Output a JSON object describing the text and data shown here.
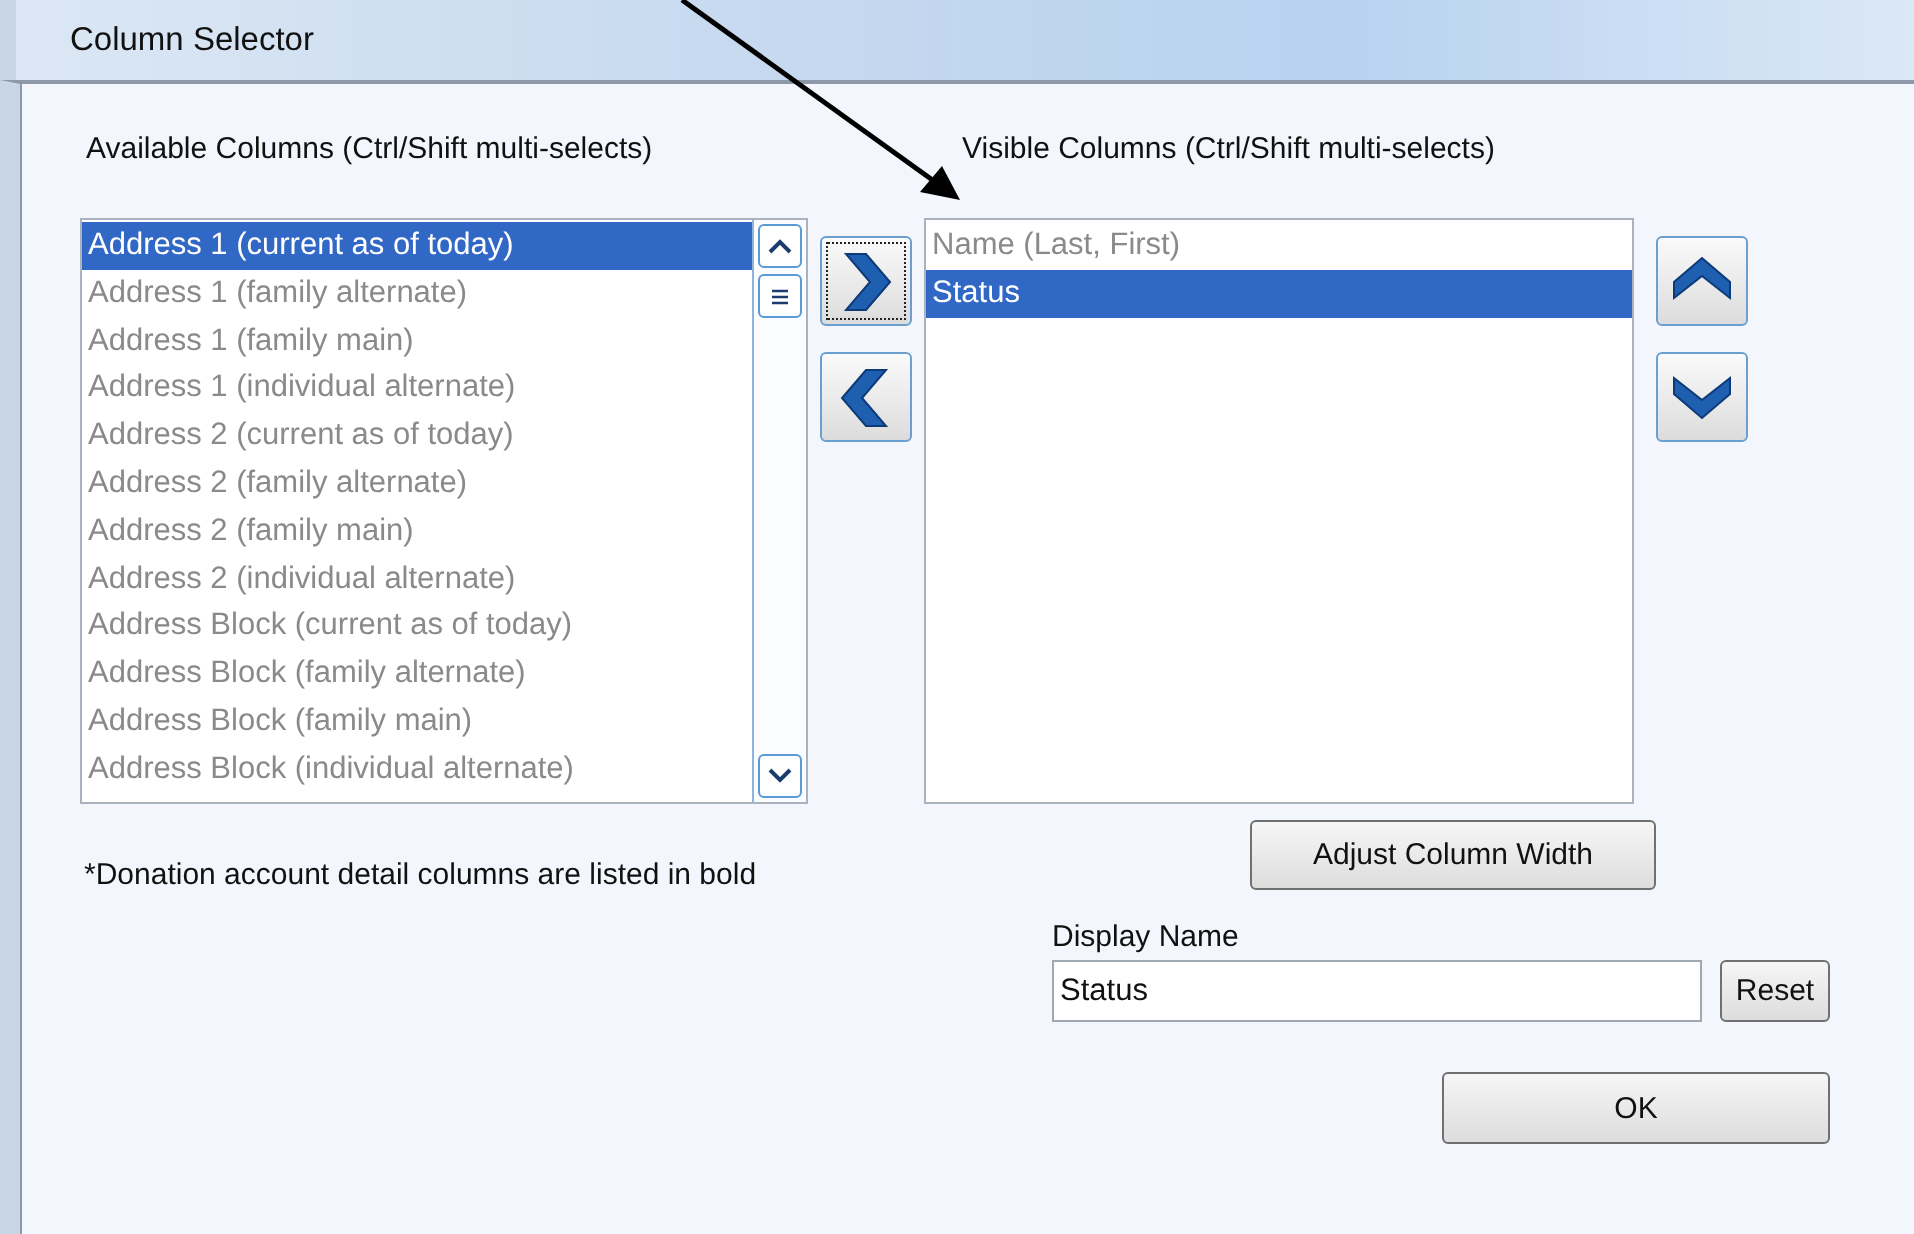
{
  "window": {
    "title": "Column Selector"
  },
  "available": {
    "label": "Available Columns (Ctrl/Shift multi-selects)",
    "items": [
      {
        "text": "Address 1 (current as of today)",
        "selected": true
      },
      {
        "text": "Address 1 (family alternate)",
        "selected": false
      },
      {
        "text": "Address 1 (family main)",
        "selected": false
      },
      {
        "text": "Address 1 (individual alternate)",
        "selected": false
      },
      {
        "text": "Address 2 (current as of today)",
        "selected": false
      },
      {
        "text": "Address 2 (family alternate)",
        "selected": false
      },
      {
        "text": "Address 2 (family main)",
        "selected": false
      },
      {
        "text": "Address 2 (individual alternate)",
        "selected": false
      },
      {
        "text": "Address Block (current as of today)",
        "selected": false
      },
      {
        "text": "Address Block (family alternate)",
        "selected": false
      },
      {
        "text": "Address Block (family main)",
        "selected": false
      },
      {
        "text": "Address Block (individual alternate)",
        "selected": false
      }
    ]
  },
  "visible": {
    "label": "Visible Columns  (Ctrl/Shift multi-selects)",
    "items": [
      {
        "text": "Name (Last, First)",
        "selected": false
      },
      {
        "text": "Status",
        "selected": true
      }
    ]
  },
  "note": "*Donation account detail columns are listed in bold",
  "adjust_button": "Adjust Column Width",
  "display_name": {
    "label": "Display Name",
    "value": "Status"
  },
  "reset_button": "Reset",
  "ok_button": "OK"
}
